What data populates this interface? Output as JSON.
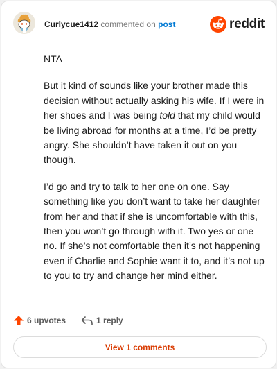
{
  "header": {
    "username": "Curlycue1412",
    "commented_on": "commented on",
    "post_link": "post",
    "brand": "reddit"
  },
  "comment": {
    "p1": "NTA",
    "p2_before": "But it kind of sounds like your brother made this decision without actually asking his wife. If I were in her shoes and I was being ",
    "p2_emph": "told",
    "p2_after": " that my child would be living abroad for months at a time, I’d be pretty angry. She shouldn’t have taken it out on you though.",
    "p3": "I’d go and try to talk to her one on one. Say something like you don’t want to take her daughter from her and that if she is uncomfortable with this, then you won’t go through with it. Two yes or one no. If she’s not comfortable then it’s not happening even if Charlie and Sophie want it to, and it’s not up to you to try and change her mind either."
  },
  "actions": {
    "upvotes": "6 upvotes",
    "reply": "1 reply"
  },
  "view_comments": "View 1 comments",
  "colors": {
    "brand_orange": "#ff4500",
    "link_blue": "#0079d3",
    "upvote_orange": "#ff4500"
  }
}
